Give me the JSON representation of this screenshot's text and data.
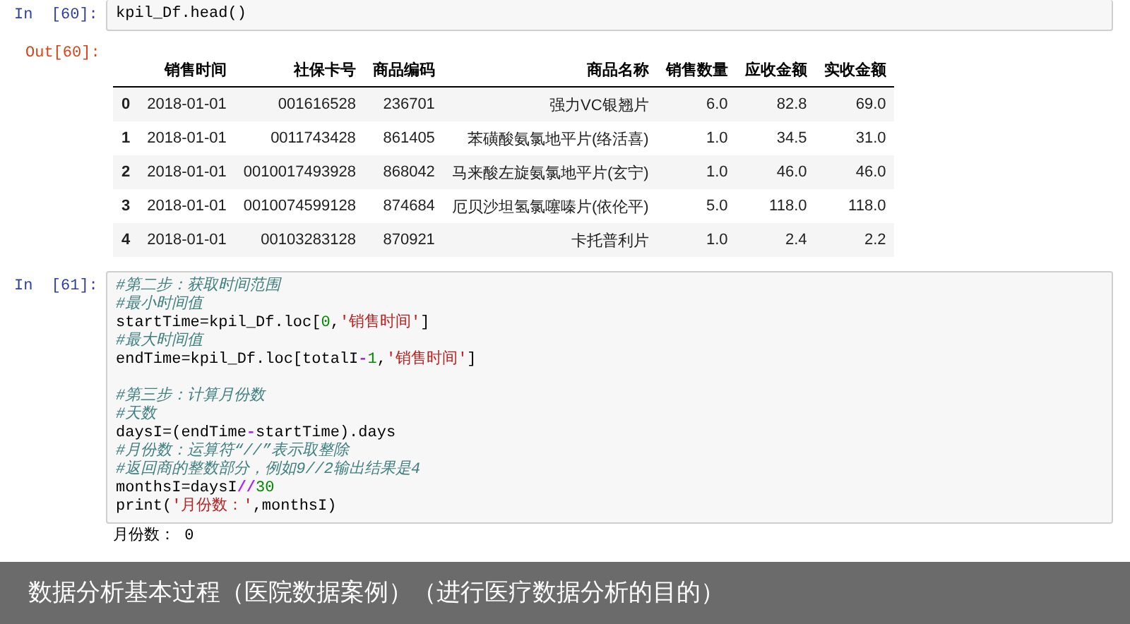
{
  "cells": [
    {
      "kind": "table",
      "in_prompt": "In  [60]:",
      "code": "kpil_Df.head()",
      "out_prompt": "Out[60]:",
      "table": {
        "columns": [
          "",
          "销售时间",
          "社保卡号",
          "商品编码",
          "商品名称",
          "销售数量",
          "应收金额",
          "实收金额"
        ],
        "rows": [
          [
            "0",
            "2018-01-01",
            "001616528",
            "236701",
            "强力VC银翘片",
            "6.0",
            "82.8",
            "69.0"
          ],
          [
            "1",
            "2018-01-01",
            "0011743428",
            "861405",
            "苯磺酸氨氯地平片(络活喜)",
            "1.0",
            "34.5",
            "31.0"
          ],
          [
            "2",
            "2018-01-01",
            "0010017493928",
            "868042",
            "马来酸左旋氨氯地平片(玄宁)",
            "1.0",
            "46.0",
            "46.0"
          ],
          [
            "3",
            "2018-01-01",
            "0010074599128",
            "874684",
            "厄贝沙坦氢氯噻嗪片(依伦平)",
            "5.0",
            "118.0",
            "118.0"
          ],
          [
            "4",
            "2018-01-01",
            "00103283128",
            "870921",
            "卡托普利片",
            "1.0",
            "2.4",
            "2.2"
          ]
        ]
      }
    },
    {
      "kind": "code",
      "in_prompt": "In  [61]:",
      "lines": [
        {
          "tokens": [
            {
              "kind": "comment",
              "text": "#第二步：获取时间范围"
            }
          ]
        },
        {
          "tokens": [
            {
              "kind": "comment",
              "text": "#最小时间值"
            }
          ]
        },
        {
          "tokens": [
            {
              "kind": "plain",
              "text": "startTime=kpil_Df.loc["
            },
            {
              "kind": "number",
              "text": "0"
            },
            {
              "kind": "plain",
              "text": ","
            },
            {
              "kind": "string",
              "text": "'销售时间'"
            },
            {
              "kind": "plain",
              "text": "]"
            }
          ]
        },
        {
          "tokens": [
            {
              "kind": "comment",
              "text": "#最大时间值"
            }
          ]
        },
        {
          "tokens": [
            {
              "kind": "plain",
              "text": "endTime=kpil_Df.loc[totalI"
            },
            {
              "kind": "operator",
              "text": "-"
            },
            {
              "kind": "number",
              "text": "1"
            },
            {
              "kind": "plain",
              "text": ","
            },
            {
              "kind": "string",
              "text": "'销售时间'"
            },
            {
              "kind": "plain",
              "text": "]"
            }
          ]
        },
        {
          "space_before": true,
          "tokens": [
            {
              "kind": "comment",
              "text": "#第三步：计算月份数"
            }
          ]
        },
        {
          "tokens": [
            {
              "kind": "comment",
              "text": "#天数"
            }
          ]
        },
        {
          "tokens": [
            {
              "kind": "plain",
              "text": "daysI=(endTime"
            },
            {
              "kind": "operator",
              "text": "-"
            },
            {
              "kind": "plain",
              "text": "startTime).days"
            }
          ]
        },
        {
          "tokens": [
            {
              "kind": "comment",
              "text": "#月份数：运算符“//”表示取整除"
            }
          ]
        },
        {
          "tokens": [
            {
              "kind": "comment",
              "text": "#返回商的整数部分，例如9//2输出结果是4"
            }
          ]
        },
        {
          "tokens": [
            {
              "kind": "plain",
              "text": "monthsI=daysI"
            },
            {
              "kind": "operator",
              "text": "//"
            },
            {
              "kind": "number",
              "text": "30"
            }
          ]
        },
        {
          "tokens": [
            {
              "kind": "plain",
              "text": "print("
            },
            {
              "kind": "string",
              "text": "'月份数：'"
            },
            {
              "kind": "plain",
              "text": ",monthsI)"
            }
          ]
        }
      ],
      "output": "月份数： 0"
    }
  ],
  "caption": "数据分析基本过程（医院数据案例）（进行医疗数据分析的目的）"
}
